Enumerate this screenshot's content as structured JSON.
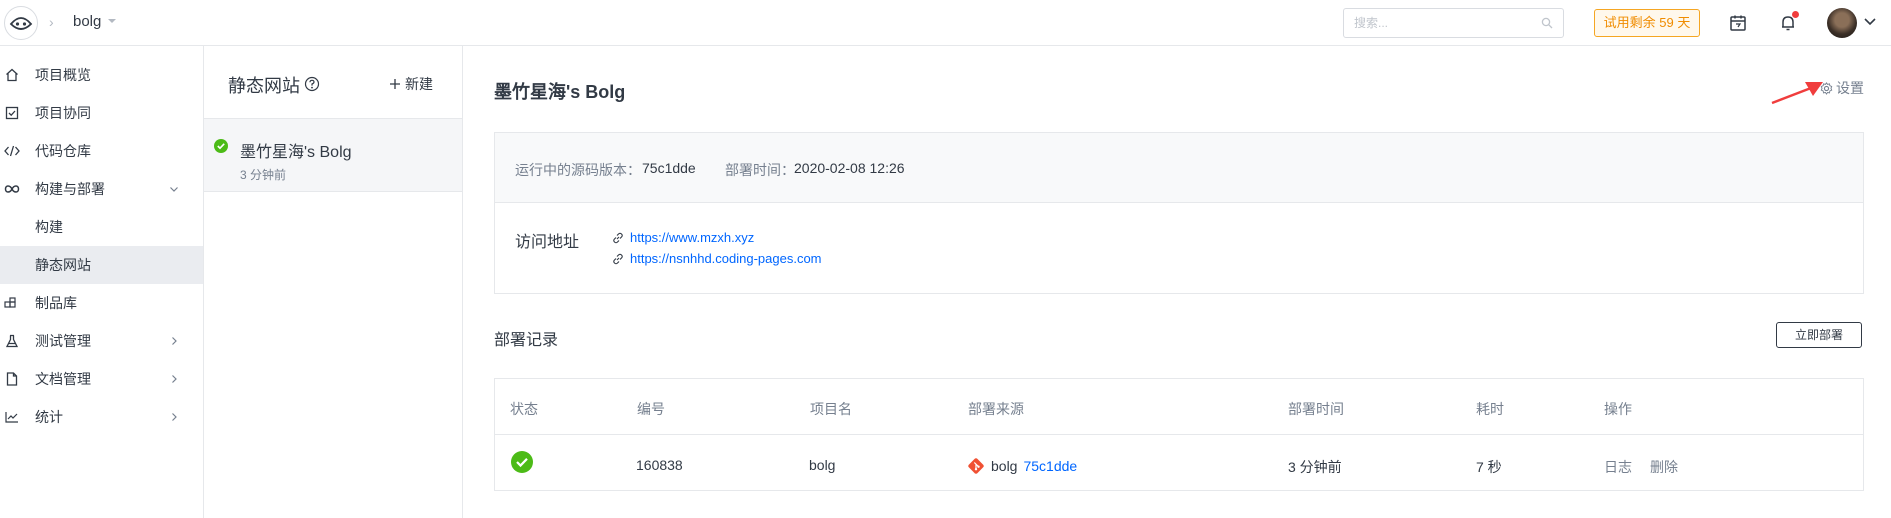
{
  "topbar": {
    "project_name": "bolg",
    "search_placeholder": "搜索...",
    "trial_text": "试用剩余 59 天"
  },
  "sidebar": {
    "items": [
      {
        "label": "项目概览",
        "icon": "home-icon"
      },
      {
        "label": "项目协同",
        "icon": "checkbox-icon"
      },
      {
        "label": "代码仓库",
        "icon": "code-icon"
      },
      {
        "label": "构建与部署",
        "icon": "infinity-icon",
        "expanded": true
      },
      {
        "label": "构建",
        "icon": null
      },
      {
        "label": "静态网站",
        "icon": null,
        "active": true
      },
      {
        "label": "制品库",
        "icon": "artifact-icon"
      },
      {
        "label": "测试管理",
        "icon": "flask-icon"
      },
      {
        "label": "文档管理",
        "icon": "document-icon"
      },
      {
        "label": "统计",
        "icon": "chart-icon"
      }
    ]
  },
  "listpanel": {
    "title": "静态网站",
    "new_label": "新建",
    "site": {
      "name": "墨竹星海's Bolg",
      "time": "3 分钟前"
    }
  },
  "main": {
    "title": "墨竹星海's Bolg",
    "settings_label": "设置",
    "version_label": "运行中的源码版本：",
    "version_value": "75c1dde",
    "deploy_time_label": "部署时间：",
    "deploy_time_value": "2020-02-08 12:26",
    "access_label": "访问地址",
    "urls": [
      "https://www.mzxh.xyz",
      "https://nsnhhd.coding-pages.com"
    ],
    "records_title": "部署记录",
    "deploy_now_label": "立即部署",
    "table": {
      "headers": [
        "状态",
        "编号",
        "项目名",
        "部署来源",
        "部署时间",
        "耗时",
        "操作"
      ],
      "rows": [
        {
          "status": "success",
          "id": "160838",
          "project": "bolg",
          "source_repo": "bolg",
          "source_commit": "75c1dde",
          "time": "3 分钟前",
          "duration": "7 秒",
          "action_log": "日志",
          "action_delete": "删除"
        }
      ]
    }
  },
  "colors": {
    "accent": "#0066ff",
    "success": "#4cbb17",
    "trial": "#f08c00",
    "annotation_arrow": "#f03d3d"
  }
}
